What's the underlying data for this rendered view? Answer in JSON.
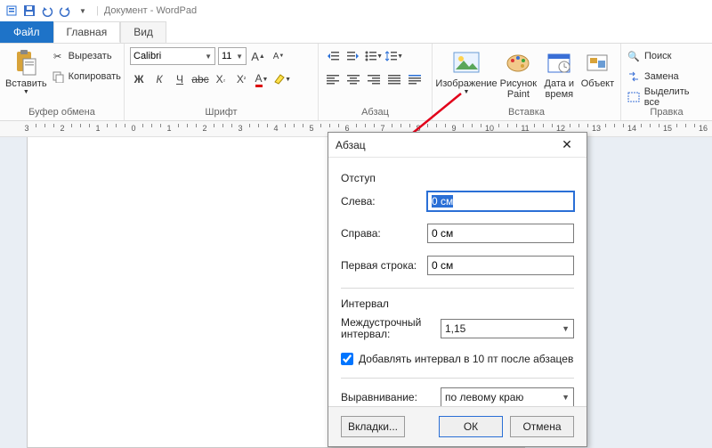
{
  "titlebar": {
    "doc": "Документ",
    "app": "WordPad"
  },
  "tabs": {
    "file": "Файл",
    "home": "Главная",
    "view": "Вид"
  },
  "ribbon": {
    "clipboard": {
      "label": "Буфер обмена",
      "paste": "Вставить",
      "cut": "Вырезать",
      "copy": "Копировать"
    },
    "font": {
      "label": "Шрифт",
      "name": "Calibri",
      "size": "11"
    },
    "paragraph": {
      "label": "Абзац"
    },
    "insert": {
      "label": "Вставка",
      "image": "Изображение",
      "paint": "Рисунок Paint",
      "datetime": "Дата и время",
      "object": "Объект"
    },
    "editing": {
      "label": "Правка",
      "find": "Поиск",
      "replace": "Замена",
      "select": "Выделить все"
    }
  },
  "dialog": {
    "title": "Абзац",
    "indent_section": "Отступ",
    "left_label": "Слева:",
    "left_value": "0 см",
    "right_label": "Справа:",
    "right_value": "0 см",
    "firstline_label": "Первая строка:",
    "firstline_value": "0 см",
    "spacing_section": "Интервал",
    "linespacing_label": "Междустрочный интервал:",
    "linespacing_value": "1,15",
    "addspace_label": "Добавлять интервал в 10 пт после абзацев",
    "align_label": "Выравнивание:",
    "align_value": "по левому краю",
    "tabs_btn": "Вкладки...",
    "ok_btn": "ОК",
    "cancel_btn": "Отмена"
  }
}
